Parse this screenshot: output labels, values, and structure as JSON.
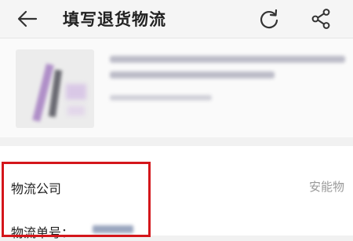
{
  "header": {
    "title": "填写退货物流",
    "back_icon": "arrow-left-icon",
    "refresh_icon": "refresh-icon",
    "share_icon": "share-icon"
  },
  "form": {
    "company_label": "物流公司",
    "company_value": "安能物",
    "tracking_label": "物流单号："
  },
  "colors": {
    "highlight_border": "#d4161b",
    "page_background": "#f1f1f1"
  }
}
